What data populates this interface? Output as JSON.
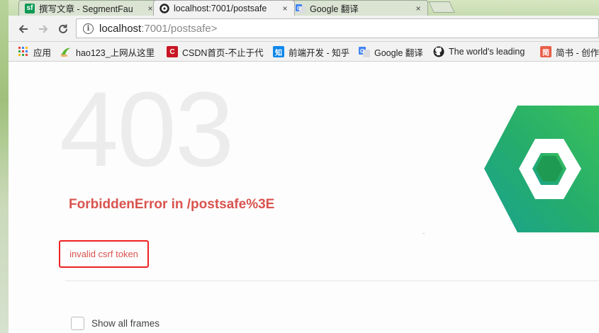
{
  "tabs": [
    {
      "title": "撰写文章 - SegmentFau",
      "favicon_text": "sf",
      "favicon": "segmentfault-icon"
    },
    {
      "title": "localhost:7001/postsafe",
      "favicon": "egg-icon"
    },
    {
      "title": "Google 翻译",
      "favicon": "google-translate-icon"
    }
  ],
  "tab_close_glyph": "×",
  "address_bar": {
    "info_glyph": "i",
    "host": "localhost",
    "path": ":7001/postsafe>"
  },
  "bookmarks": [
    {
      "label": "应用",
      "icon": "apps-grid-icon"
    },
    {
      "label": "hao123_上网从这里",
      "icon": "hao123-icon"
    },
    {
      "label": "CSDN首页-不止于代",
      "icon": "csdn-icon",
      "icon_text": "C"
    },
    {
      "label": "前端开发 - 知乎",
      "icon": "zhihu-icon",
      "icon_text": "知"
    },
    {
      "label": "Google 翻译",
      "icon": "google-translate-icon"
    },
    {
      "label": "The world's leading",
      "icon": "github-icon"
    },
    {
      "label": "简书 - 创作",
      "icon": "jianshu-icon",
      "icon_text": "简"
    }
  ],
  "error": {
    "status_code": "403",
    "title": "ForbiddenError in /postsafe%3E",
    "message": "invalid csrf token"
  },
  "show_all_frames_label": "Show all frames",
  "colors": {
    "error_red": "#d9534f",
    "highlight_box": "#ee2222",
    "logo_green": "#2fb457",
    "logo_teal": "#1ba38c"
  }
}
